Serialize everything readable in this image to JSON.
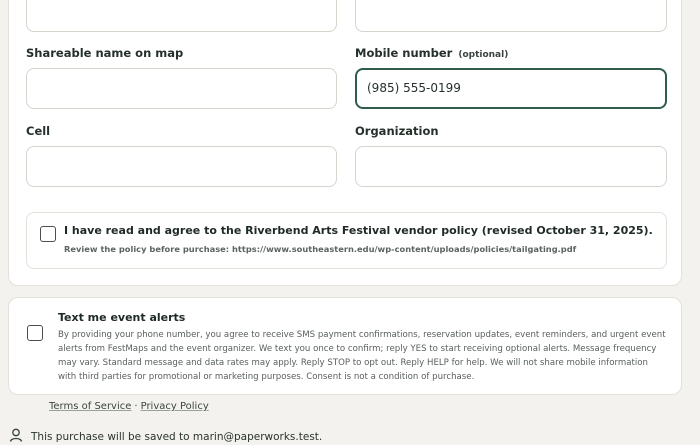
{
  "form": {
    "shareable_name_label": "Shareable name on map",
    "shareable_name_value": "",
    "mobile_label": "Mobile number",
    "mobile_optional": "(optional)",
    "mobile_value": "(985) 555-0199",
    "cell_label": "Cell",
    "cell_value": "",
    "organization_label": "Organization",
    "organization_value": ""
  },
  "policy": {
    "checked": false,
    "agree_text": "I have read and agree to the Riverbend Arts Festival vendor policy (revised October 31, 2025).",
    "review_text": "Review the policy before purchase: https://www.southeastern.edu/wp-content/uploads/policies/tailgating.pdf"
  },
  "alerts": {
    "checked": false,
    "title": "Text me event alerts",
    "body": "By providing your phone number, you agree to receive SMS payment confirmations, reservation updates, event reminders, and urgent event alerts from FestMaps and the event organizer. We text you once to confirm; reply YES to start receiving optional alerts. Message frequency may vary. Standard message and data rates may apply. Reply STOP to opt out. Reply HELP for help. We will not share mobile information with third parties for promotional or marketing purposes. Consent is not a condition of purchase."
  },
  "footer": {
    "terms_label": "Terms of Service",
    "separator": "·",
    "privacy_label": "Privacy Policy",
    "saved_text": "This purchase will be saved to marin@paperworks.test."
  },
  "colors": {
    "focus_border": "#2f5d4a",
    "background": "#f3f2ee"
  },
  "icons": {
    "saved": "user-icon"
  }
}
